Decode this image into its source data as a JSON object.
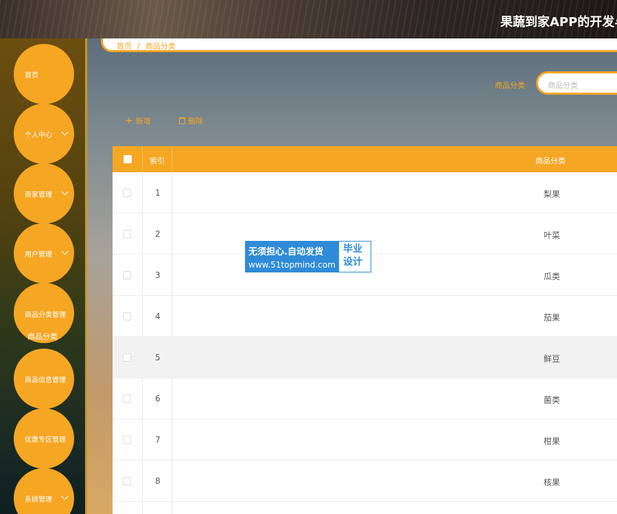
{
  "header": {
    "title": "果蔬到家APP的开发与"
  },
  "sidebar": {
    "items": [
      {
        "label": "首页",
        "has_chevron": false
      },
      {
        "label": "个人中心",
        "has_chevron": true
      },
      {
        "label": "商家管理",
        "has_chevron": true
      },
      {
        "label": "用户管理",
        "has_chevron": true
      },
      {
        "label": "商品分类管理",
        "has_chevron": false
      },
      {
        "label": "商品信息管理",
        "has_chevron": false
      },
      {
        "label": "优惠专区管理",
        "has_chevron": false
      },
      {
        "label": "系统管理",
        "has_chevron": true
      }
    ],
    "sub_item": "商品分类"
  },
  "breadcrumb": {
    "home": "首页",
    "separator": "/",
    "current": "商品分类"
  },
  "search": {
    "label": "商品分类",
    "placeholder": "商品分类"
  },
  "toolbar": {
    "add_label": "新增",
    "delete_label": "删除"
  },
  "table": {
    "headers": {
      "index": "索引",
      "category": "商品分类"
    },
    "rows": [
      {
        "index": "1",
        "category": "梨果"
      },
      {
        "index": "2",
        "category": "叶菜"
      },
      {
        "index": "3",
        "category": "瓜类"
      },
      {
        "index": "4",
        "category": "茄果"
      },
      {
        "index": "5",
        "category": "鲜豆"
      },
      {
        "index": "6",
        "category": "菌类"
      },
      {
        "index": "7",
        "category": "柑果"
      },
      {
        "index": "8",
        "category": "核果"
      }
    ]
  },
  "watermark": {
    "line1": "无须担心.自动发货",
    "line2": "www.51topmind.com",
    "right1": "毕业",
    "right2": "设计"
  },
  "colors": {
    "accent": "#f5a623",
    "watermark_blue": "#2f8bd8"
  }
}
